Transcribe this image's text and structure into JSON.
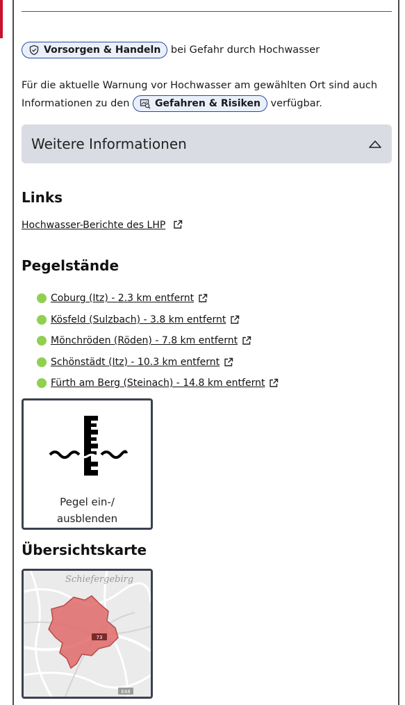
{
  "intro": {
    "vorsorgen_label": "Vorsorgen & Handeln",
    "vorsorgen_suffix": "bei Gefahr durch Hochwasser",
    "warning_text_part1": "Für die aktuelle Warnung vor Hochwasser am gewählten Ort sind auch Informationen zu den",
    "gefahren_label": "Gefahren & Risiken",
    "warning_text_part2": "verfügbar."
  },
  "accordion": {
    "title": "Weitere Informationen",
    "expanded": true
  },
  "links": {
    "heading": "Links",
    "items": [
      {
        "label": "Hochwasser-Berichte des LHP"
      }
    ]
  },
  "pegel": {
    "heading": "Pegelstände",
    "items": [
      {
        "label": " Coburg (Itz) - 2.3 km entfernt",
        "status_color": "#8fd14f"
      },
      {
        "label": " Kösfeld (Sulzbach) - 3.8 km entfernt",
        "status_color": "#8fd14f"
      },
      {
        "label": " Mönchröden (Röden) - 7.8 km entfernt",
        "status_color": "#8fd14f"
      },
      {
        "label": " Schönstädt (Itz) - 10.3 km entfernt",
        "status_color": "#8fd14f"
      },
      {
        "label": " Fürth am Berg (Steinach) - 14.8 km entfernt",
        "status_color": "#8fd14f"
      }
    ],
    "toggle_label_line1": "Pegel ein-/",
    "toggle_label_line2": "ausblenden"
  },
  "map": {
    "heading": "Übersichtskarte",
    "place_label": "Schiefergebirg",
    "road_label_1": "73",
    "road_label_2": "E48",
    "region_color": "#e06a6a"
  },
  "colors": {
    "accent_border": "#2a4a9a",
    "frame": "#4a4a4a",
    "status_ok": "#8fd14f"
  }
}
